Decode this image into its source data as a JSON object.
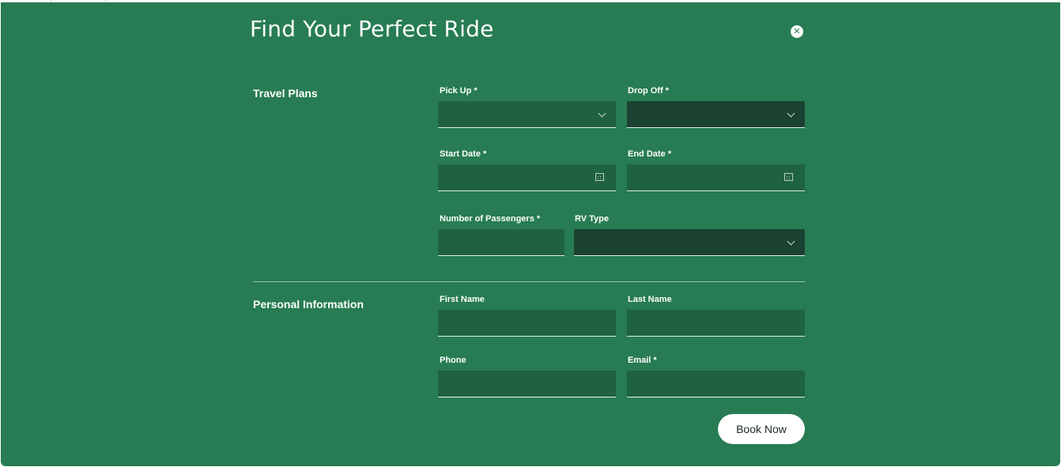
{
  "modal": {
    "title": "Find Your Perfect Ride",
    "close_icon": "close-icon"
  },
  "travel_plans": {
    "heading": "Travel Plans",
    "pick_up": {
      "label": "Pick Up *",
      "value": ""
    },
    "drop_off": {
      "label": "Drop Off *",
      "value": ""
    },
    "start_date": {
      "label": "Start Date *",
      "value": ""
    },
    "end_date": {
      "label": "End Date *",
      "value": ""
    },
    "passengers": {
      "label": "Number of Passengers *",
      "value": ""
    },
    "rv_type": {
      "label": "RV Type",
      "value": ""
    }
  },
  "personal_info": {
    "heading": "Personal Information",
    "first_name": {
      "label": "First Name",
      "value": ""
    },
    "last_name": {
      "label": "Last Name",
      "value": ""
    },
    "phone": {
      "label": "Phone",
      "value": ""
    },
    "email": {
      "label": "Email *",
      "value": ""
    }
  },
  "actions": {
    "book_label": "Book Now"
  },
  "colors": {
    "panel": "#277c53",
    "field": "#1f6241",
    "field_dark": "#1b4231",
    "text": "#ffffff"
  }
}
